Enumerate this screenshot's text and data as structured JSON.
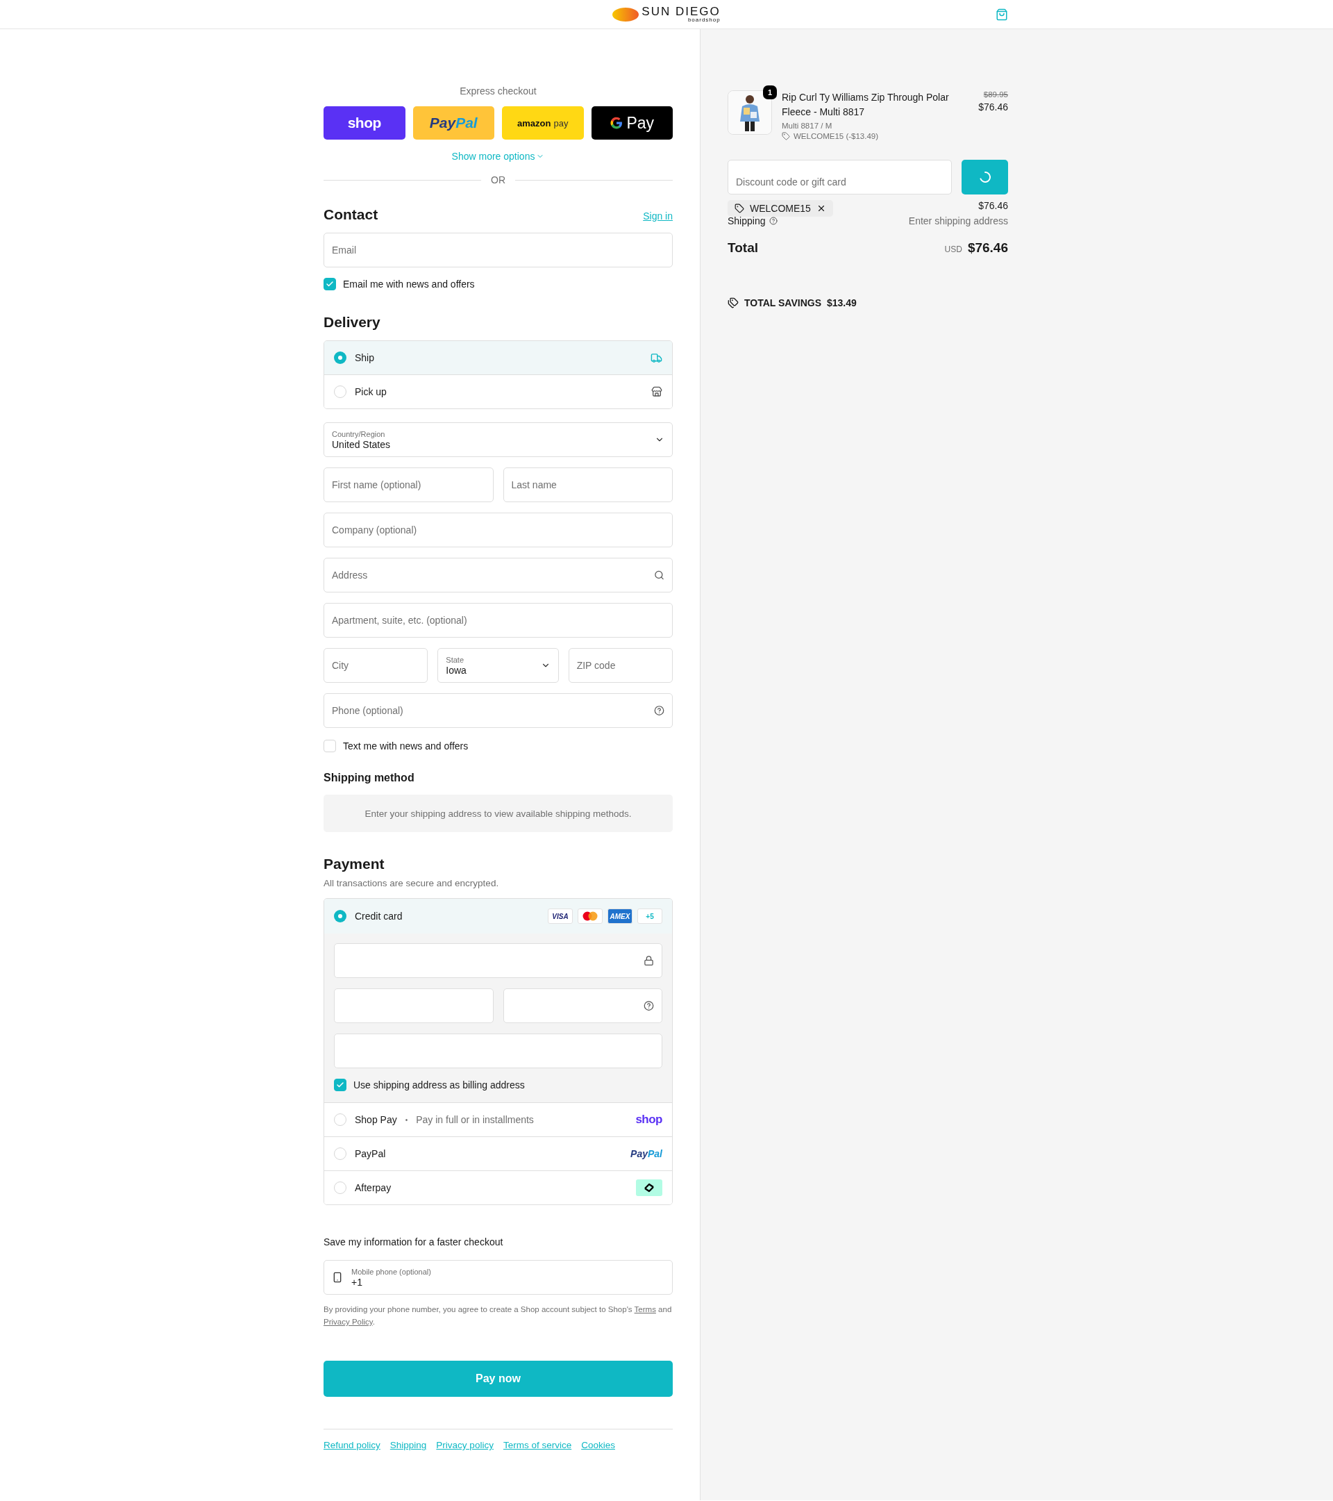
{
  "header": {
    "logo": {
      "wordmark": "SUN DIEGO",
      "tagline": "boardshop"
    }
  },
  "express": {
    "label": "Express checkout",
    "buttons": [
      {
        "kind": "shop",
        "parts": [
          "shop"
        ]
      },
      {
        "kind": "paypal",
        "parts": [
          "Pay",
          "Pal"
        ]
      },
      {
        "kind": "amazon",
        "parts": [
          "amazon",
          "pay"
        ]
      },
      {
        "kind": "gpay",
        "parts": [
          "Pay"
        ]
      }
    ],
    "show_more": "Show more options",
    "divider": "OR"
  },
  "contact": {
    "title": "Contact",
    "sign_in": "Sign in",
    "email_placeholder": "Email",
    "news": {
      "label": "Email me with news and offers",
      "checked": true
    }
  },
  "delivery": {
    "title": "Delivery",
    "options": [
      {
        "kind": "ship",
        "label": "Ship",
        "selected": true
      },
      {
        "kind": "pickup",
        "label": "Pick up",
        "selected": false
      }
    ],
    "rows": [
      [
        {
          "kind": "select",
          "label": "Country/Region",
          "value": "United States"
        }
      ],
      [
        {
          "kind": "text",
          "placeholder": "First name (optional)"
        },
        {
          "kind": "text",
          "placeholder": "Last name"
        }
      ],
      [
        {
          "kind": "text",
          "placeholder": "Company (optional)"
        }
      ],
      [
        {
          "kind": "search",
          "placeholder": "Address"
        }
      ],
      [
        {
          "kind": "text",
          "placeholder": "Apartment, suite, etc. (optional)"
        }
      ],
      [
        {
          "kind": "text",
          "placeholder": "City"
        },
        {
          "kind": "select",
          "label": "State",
          "value": "Iowa"
        },
        {
          "kind": "text",
          "placeholder": "ZIP code"
        }
      ],
      [
        {
          "kind": "help",
          "placeholder": "Phone (optional)"
        }
      ]
    ],
    "sms": {
      "label": "Text me with news and offers",
      "checked": false
    }
  },
  "shipping_method": {
    "title": "Shipping method",
    "message": "Enter your shipping address to view available shipping methods."
  },
  "payment": {
    "title": "Payment",
    "subtitle": "All transactions are secure and encrypted.",
    "methods": [
      {
        "kind": "card",
        "label": "Credit card",
        "selected": true,
        "brands": [
          {
            "kind": "visa",
            "label": "VISA"
          },
          {
            "kind": "mastercard"
          },
          {
            "kind": "amex",
            "label": "AMEX"
          },
          {
            "kind": "more",
            "label": "+5"
          }
        ],
        "billing": {
          "label": "Use shipping address as billing address",
          "checked": true
        }
      },
      {
        "kind": "shoppay",
        "label": "Shop Pay",
        "separator": "•",
        "note": "Pay in full or in installments",
        "logo": [
          "shop"
        ],
        "selected": false
      },
      {
        "kind": "paypal",
        "label": "PayPal",
        "logo": [
          "Pay",
          "Pal"
        ],
        "selected": false
      },
      {
        "kind": "afterpay",
        "label": "Afterpay",
        "selected": false
      }
    ]
  },
  "save": {
    "title": "Save my information for a faster checkout",
    "phone": {
      "label": "Mobile phone (optional)",
      "value": "+1"
    },
    "disclaimer": {
      "text": "By providing your phone number, you agree to create a Shop account subject to Shop's",
      "terms": "Terms",
      "joiner": "and",
      "privacy": "Privacy Policy",
      "end": "."
    }
  },
  "pay_button": "Pay now",
  "footer_links": [
    "Refund policy",
    "Shipping",
    "Privacy policy",
    "Terms of service",
    "Cookies"
  ],
  "summary": {
    "item": {
      "quantity": "1",
      "title": "Rip Curl Ty Williams Zip Through Polar Fleece - Multi 8817",
      "variant": "Multi 8817 / M",
      "discount": "WELCOME15 (-$13.49)",
      "compare_price": "$89.95",
      "price": "$76.46"
    },
    "discount_placeholder": "Discount code or gift card",
    "applied_code": "WELCOME15",
    "subtotal_value": "$76.46",
    "shipping": {
      "label": "Shipping",
      "value": "Enter shipping address"
    },
    "total": {
      "label": "Total",
      "currency": "USD",
      "value": "$76.46"
    },
    "savings": {
      "label": "TOTAL SAVINGS",
      "value": "$13.49"
    }
  }
}
